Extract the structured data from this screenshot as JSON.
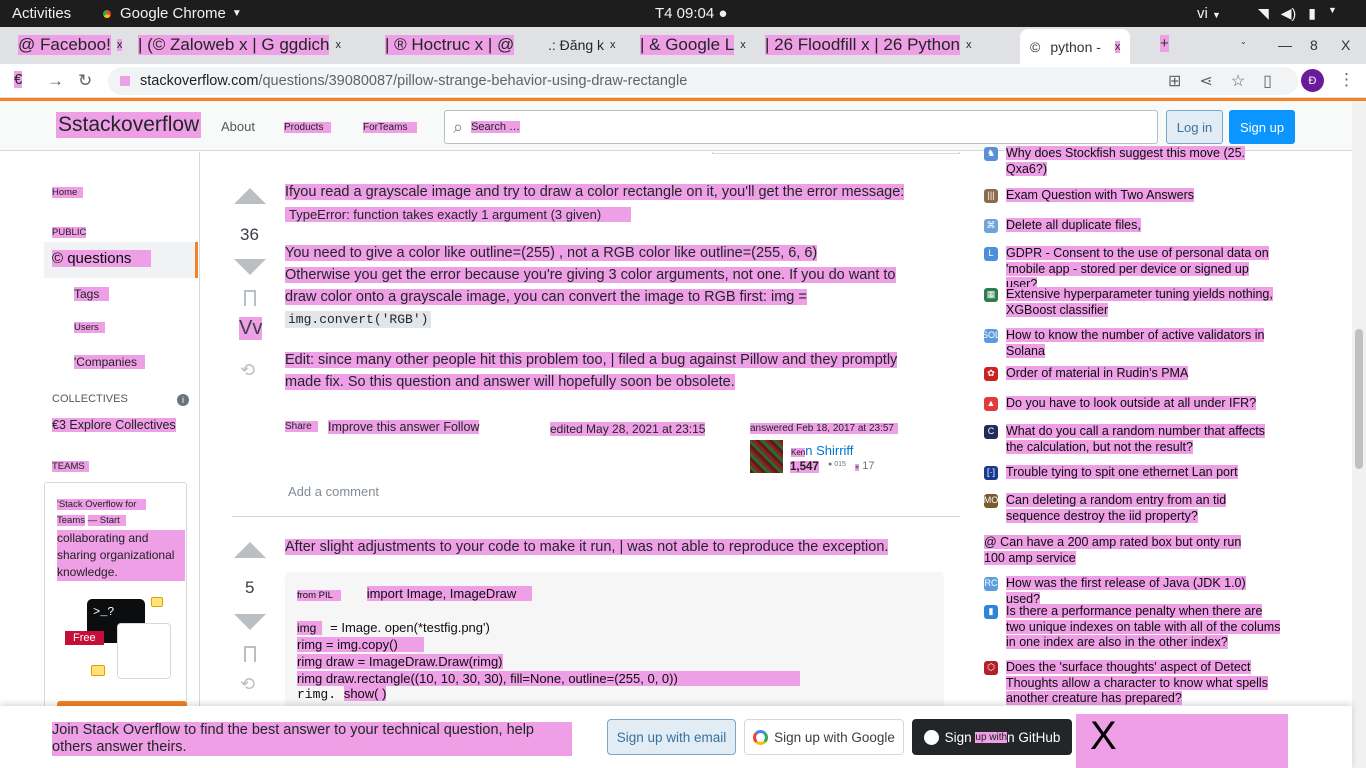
{
  "os": {
    "activities": "Activities",
    "app_name": "Google Chrome",
    "clock": "T4 09:04",
    "lang": "vi"
  },
  "tabs": [
    {
      "label": "@ Faceboo!",
      "close": "x"
    },
    {
      "label": "| (© Zaloweb x | G ggdich",
      "close": "x"
    },
    {
      "label": "| ® Hoctruc x | @",
      "close": ""
    },
    {
      "label": ".: Đăng k",
      "close": "x"
    },
    {
      "label": "| & Google L",
      "close": "x"
    },
    {
      "label": "| 26 Floodfill x | 26 Python",
      "close": "x"
    },
    {
      "label": "python -",
      "close": "x"
    }
  ],
  "new_tab": "+",
  "window_controls": {
    "min": "—",
    "max": "8",
    "close": "X"
  },
  "address": {
    "host": "stackoverflow.com",
    "path": "/questions/39080087/pillow-strange-behavior-using-draw-rectangle",
    "left_glyph": "€",
    "profile_initial": "Đ"
  },
  "so_header": {
    "logo": "Sstackoverflow",
    "about": "About",
    "products": "Products",
    "for_teams": "ForTeams",
    "search_placeholder": "Search …",
    "login": "Log in",
    "signup": "Sign up"
  },
  "left_nav": {
    "home": "Home",
    "public": "PUBLIC",
    "questions": "© questions",
    "tags": "Tags",
    "users": "Users",
    "companies": "'Companies",
    "collectives": "COLLECTIVES",
    "explore": "€3 Explore Collectives",
    "teams": "TEAMS",
    "teams_box_line1": "'Stack Overflow for",
    "teams_box_line2a": "Teams",
    "teams_box_line2b": "— Start",
    "teams_box_body": "collaborating and sharing organizational knowledge.",
    "free": "Free",
    "terminal": ">_?"
  },
  "answer1": {
    "score": "36",
    "vv": "Vv",
    "p1": "Ifyou read a grayscale image and try to draw a color rectangle on it, you'll get the error message:",
    "error_line": "TypeError: function takes exactly 1 argument (3 given)",
    "p2_line1": "You need to give a color like outline=(255) , not a RGB color like outline=(255, 6, 6)",
    "p2_line2": "Otherwise you get the error because you're giving 3 color arguments, not one. If you do want to",
    "p2_line3": "draw color onto a grayscale image, you can convert the image to RGB first: img =",
    "p2_code": "img.convert('RGB')",
    "p3_line1": "Edit: since many other people hit this problem too, | filed a bug against Pillow and they promptly",
    "p3_line2": "made fix. So this question and answer will hopefully soon be obsolete.",
    "share": "Share",
    "improve_follow": "Improve this answer Follow",
    "edited": "edited May 28, 2021 at 23:15",
    "answered": "answered Feb 18, 2017 at 23:57",
    "user_prefix": "Ken",
    "user_name": "n Shirriff",
    "rep": "1,547",
    "badge1": "015",
    "badge2": "17",
    "add_comment": "Add a comment"
  },
  "answer2": {
    "score": "5",
    "p1": "After slight adjustments to your code to make it run, | was not able to reproduce the exception.",
    "code": [
      {
        "pre": "from PIL",
        "main": "import Image, ImageDraw"
      },
      {
        "pre": "",
        "main": ""
      },
      {
        "pre": "img",
        "main": "=   Image. open(*testfig.png')"
      },
      {
        "pre": "",
        "main": "rimg = img.copy()"
      },
      {
        "pre": "",
        "main": "rimg  draw = ImageDraw.Draw(rimg)"
      },
      {
        "pre": "",
        "main": "rimg  draw.rectangle((10, 10, 30, 30), fill=None, outline=(255, 0, 0))"
      },
      {
        "pre": "rimg.",
        "main": "show( )"
      }
    ]
  },
  "hot_questions": [
    {
      "icon": "chess",
      "color": "#5b8fd6",
      "text": "Why does Stockfish suggest this move (25. Qxa6?)"
    },
    {
      "icon": "books",
      "color": "#8a6b4a",
      "text": "Exam Question with Two Answers"
    },
    {
      "icon": "cmd",
      "color": "#6fa3d9",
      "text": "Delete all duplicate files,"
    },
    {
      "icon": "law",
      "color": "#4d8ed8",
      "text": "GDPR - Consent to the use of personal data on 'mobile app - stored per device or signed up user?"
    },
    {
      "icon": "grid",
      "color": "#2f7d4f",
      "text": "Extensive hyperparameter tuning yields nothing, XGBoost classifier"
    },
    {
      "icon": "sol",
      "color": "#5d9be0",
      "text": "How to know the number of active validators in Solana"
    },
    {
      "icon": "math",
      "color": "#cc2222",
      "text": "Order of material in Rudin's PMA"
    },
    {
      "icon": "av",
      "color": "#e23b3b",
      "text": "Do you have to look outside at all under IFR?"
    },
    {
      "icon": "cs",
      "color": "#1f2d5a",
      "text": "What do you call a random number that affects the calculation, but not the result?"
    },
    {
      "icon": "net",
      "color": "#1a3a8f",
      "text": "Trouble tying to spit one ethernet Lan port"
    },
    {
      "icon": "mo",
      "color": "#7a5c2c",
      "text": "Can deleting a random entry from an tid sequence destroy the iid property?"
    },
    {
      "icon": "diy",
      "color": "#444444",
      "text": "@ Can have a 200 amp rated box but onty run 100 amp service"
    },
    {
      "icon": "rc",
      "color": "#5b9ee0",
      "text": "How was the first release of Java (JDK 1.0) used?"
    },
    {
      "icon": "db",
      "color": "#2f86d6",
      "text": "Is there a performance penalty when there are two unique indexes on table with all of the colums in one index are also in the other index?"
    },
    {
      "icon": "rpg",
      "color": "#b3202a",
      "text": "Does the 'surface thoughts' aspect of Detect Thoughts allow a character to know what spells another creature has prepared?"
    }
  ],
  "banner": {
    "message": "Join Stack Overflow to find the best answer to your technical question, help others answer theirs.",
    "email": "Sign up with email",
    "google": "Sign up with Google",
    "github_a": "Sign",
    "github_b": "up with",
    "github_c": "n GitHub",
    "close": "X"
  }
}
